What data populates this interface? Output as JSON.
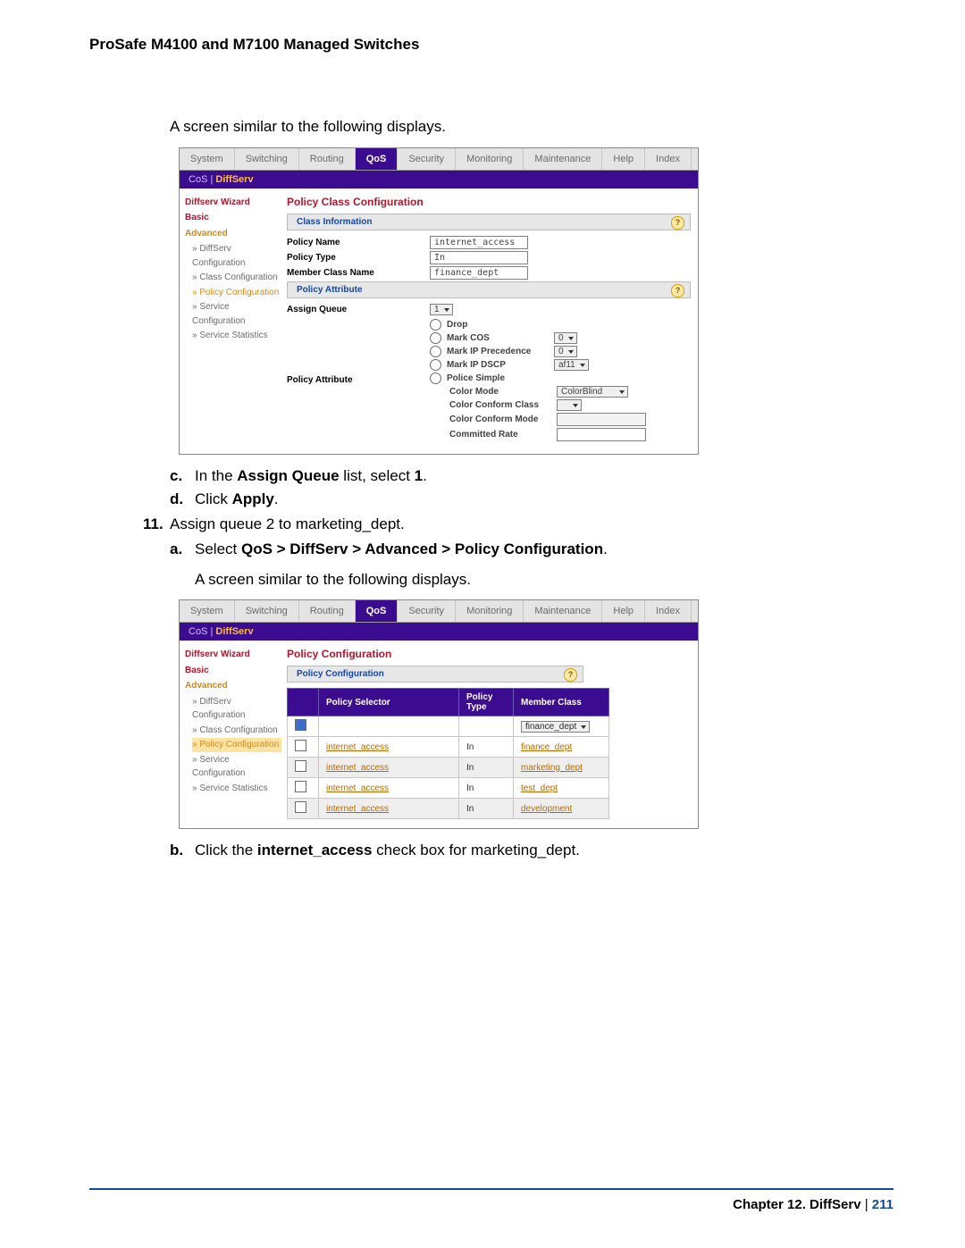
{
  "header_title": "ProSafe M4100 and M7100 Managed Switches",
  "intro1": "A screen similar to the following displays.",
  "step_c_prefix": "c.",
  "step_c_text1": "In the ",
  "step_c_bold": "Assign Queue",
  "step_c_text2": " list, select ",
  "step_c_bold2": "1",
  "step_c_text3": ".",
  "step_d_prefix": "d.",
  "step_d_text1": "Click ",
  "step_d_bold": "Apply",
  "step_d_text2": ".",
  "step11_prefix": "11.",
  "step11_text": "Assign queue 2 to marketing_dept.",
  "step_a_prefix": "a.",
  "step_a_text1": "Select ",
  "step_a_bold": "QoS > DiffServ > Advanced > Policy Configuration",
  "step_a_text2": ".",
  "intro2": "A screen similar to the following displays.",
  "step_b_prefix": "b.",
  "step_b_text1": "Click the ",
  "step_b_bold": "internet_access",
  "step_b_text2": " check box for marketing_dept.",
  "footer_chapter": "Chapter 12.  DiffServ",
  "footer_sep": "   |   ",
  "footer_page": "211",
  "tabs": {
    "items": [
      "System",
      "Switching",
      "Routing",
      "QoS",
      "Security",
      "Monitoring",
      "Maintenance",
      "Help",
      "Index"
    ],
    "active": "QoS"
  },
  "subbar": {
    "left": "CoS",
    "sep": " | ",
    "active": "DiffServ"
  },
  "nav": {
    "wizard": "Diffserv Wizard",
    "basic": "Basic",
    "advanced": "Advanced",
    "diffserv": "DiffServ Configuration",
    "classcfg": "Class Configuration",
    "policycfg": "Policy Configuration",
    "servicecfg": "Service Configuration",
    "stats": "Service Statistics"
  },
  "shot1": {
    "title": "Policy Class Configuration",
    "section1": "Class Information",
    "policy_name_label": "Policy Name",
    "policy_name_value": "internet_access",
    "policy_type_label": "Policy Type",
    "policy_type_value": "In",
    "member_class_label": "Member Class Name",
    "member_class_value": "finance_dept",
    "section2": "Policy Attribute",
    "assign_queue_label": "Assign Queue",
    "assign_queue_value": "1",
    "policy_attr_label": "Policy Attribute",
    "opts": {
      "drop": "Drop",
      "mark_cos": "Mark COS",
      "mark_cos_v": "0",
      "mark_ippr": "Mark IP Precedence",
      "mark_ippr_v": "0",
      "mark_dscp": "Mark IP DSCP",
      "mark_dscp_v": "af11",
      "police": "Police Simple",
      "color_mode": "Color Mode",
      "color_mode_v": "ColorBlind",
      "color_conf_class": "Color Conform Class",
      "color_conf_mode": "Color Conform Mode",
      "committed_rate": "Committed Rate"
    }
  },
  "shot2": {
    "title": "Policy Configuration",
    "section": "Policy Configuration",
    "cols": {
      "sel": "Policy Selector",
      "type": "Policy Type",
      "mem": "Member Class"
    },
    "member_dd": "finance_dept",
    "rows": [
      {
        "p": "internet_access",
        "t": "In",
        "m": "finance_dept"
      },
      {
        "p": "internet_access",
        "t": "In",
        "m": "marketing_dept"
      },
      {
        "p": "internet_access",
        "t": "In",
        "m": "test_dept"
      },
      {
        "p": "internet_access",
        "t": "In",
        "m": "development"
      }
    ]
  }
}
